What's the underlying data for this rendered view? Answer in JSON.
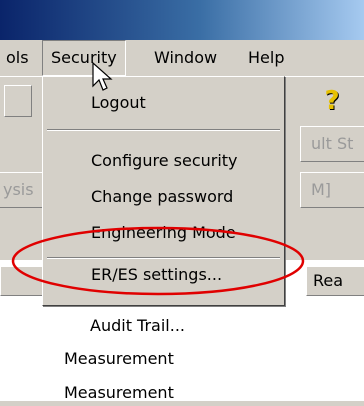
{
  "menubar": {
    "items": [
      {
        "label": "ols"
      },
      {
        "label": "Security"
      },
      {
        "label": "Window"
      },
      {
        "label": "Help"
      }
    ]
  },
  "dropdown": {
    "items": [
      {
        "label": "Logout"
      },
      {
        "label": "Configure security"
      },
      {
        "label": "Change password"
      },
      {
        "label": "Engineering Mode"
      },
      {
        "label": "ER/ES settings..."
      },
      {
        "label": "Audit Trail..."
      }
    ]
  },
  "background": {
    "ghost_left": "ysis",
    "ghost_right_1": "ult St",
    "ghost_right_2": "M]",
    "column_header": "Rea",
    "rows": [
      "Measurement",
      "Measurement"
    ]
  },
  "colors": {
    "title_bar": "#0a246a",
    "highlight_ellipse": "#e00000",
    "help_icon": "#e6c000"
  }
}
